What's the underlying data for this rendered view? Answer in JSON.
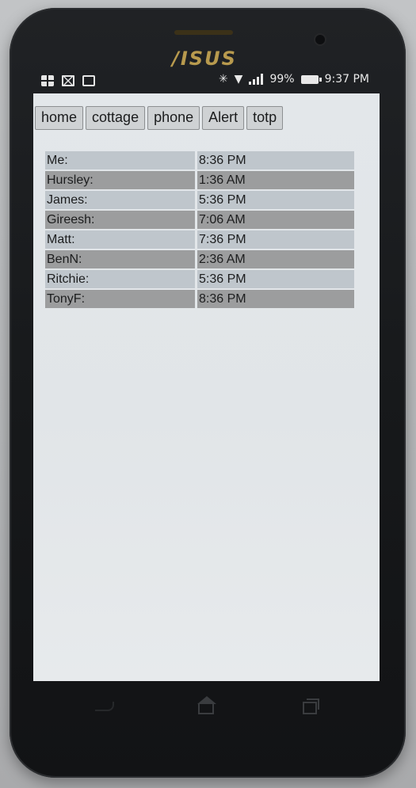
{
  "device": {
    "brand": "/ISUS"
  },
  "statusbar": {
    "battery": "99%",
    "time": "9:37 PM",
    "left_icons": [
      "flipboard-icon",
      "gmail-icon",
      "briefcase-icon"
    ],
    "right_icons": [
      "bluetooth-icon",
      "wifi-icon",
      "signal-icon",
      "battery-icon"
    ]
  },
  "tabs": [
    {
      "label": "home"
    },
    {
      "label": "cottage"
    },
    {
      "label": "phone"
    },
    {
      "label": "Alert"
    },
    {
      "label": "totp"
    }
  ],
  "times": [
    {
      "name": "Me:",
      "time": "8:36 PM"
    },
    {
      "name": "Hursley:",
      "time": "1:36 AM"
    },
    {
      "name": "James:",
      "time": "5:36 PM"
    },
    {
      "name": "Gireesh:",
      "time": "7:06 AM"
    },
    {
      "name": "Matt:",
      "time": "7:36 PM"
    },
    {
      "name": "BenN:",
      "time": "2:36 AM"
    },
    {
      "name": "Ritchie:",
      "time": "5:36 PM"
    },
    {
      "name": "TonyF:",
      "time": "8:36 PM"
    }
  ],
  "colors": {
    "row_light": "#bfc6cc",
    "row_dark": "#9c9d9e",
    "screen_bg": "#e3e7ea",
    "tab_bg": "#cfd2d4"
  }
}
